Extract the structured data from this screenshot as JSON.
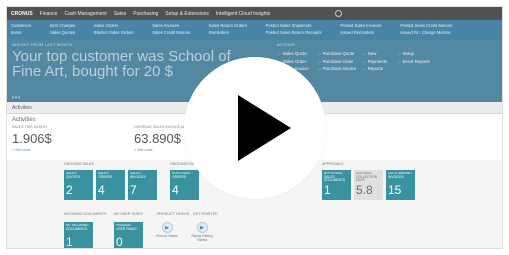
{
  "topbar": {
    "company": "CRONUS",
    "menus": [
      "Finance",
      "Cash Management",
      "Sales",
      "Purchasing",
      "Setup & Extensions",
      "Intelligent Cloud Insights"
    ]
  },
  "ribbon": {
    "links": [
      "Customers",
      "Item Charges",
      "Sales Orders",
      "Sales Invoices",
      "Sales Return Orders",
      "Posted Sales Shipments",
      "Posted Sales Invoices",
      "Posted Sales Credit Memos",
      "Items",
      "Sales Quotes",
      "Blanket Sales Orders",
      "Sales Credit Memos",
      "Reminders",
      "Posted Sales Return Receipts",
      "Issued Reminders",
      "Issued Fin. Charge Memos"
    ]
  },
  "hero": {
    "panel_label": "INSIGHT FROM LAST MONTH",
    "actions_label": "ACTIONS",
    "headline": "Your top customer was School of Fine Art, bought for 20 $",
    "actions": [
      [
        "Sales Quote",
        "Sales Order",
        "Sales Invoice"
      ],
      [
        "Purchase Quote",
        "Purchase Order",
        "Purchase Invoice"
      ],
      [
        "New",
        "Payments",
        "Reports"
      ],
      [
        "Setup",
        "Excel Reports"
      ]
    ],
    "dots": "• • •"
  },
  "activities": {
    "bar_label": "Activities",
    "title": "Activities",
    "cues": [
      {
        "label": "SALES THIS MONTH",
        "value": "1.906$",
        "link": "> See more"
      },
      {
        "label": "OVERDUE SALES INVOICE AMOUNT",
        "value": "63.890$",
        "link": "> See more"
      }
    ]
  },
  "cards": {
    "groups": [
      "ONGOING SALES",
      "ONGOING PURCHASES",
      "APPROVALS"
    ],
    "tiles": [
      {
        "label": "SALES QUOTES",
        "value": "2"
      },
      {
        "label": "SALES ORDERS",
        "value": "4"
      },
      {
        "label": "SALES INVOICES",
        "value": "7"
      },
      {
        "label": "PURCHASE ORDERS",
        "value": "4"
      },
      {
        "label": "APPROVED SALES DOCUMENTS",
        "value": "1"
      },
      {
        "label": "AVERAGE COLLECTION DAYS",
        "value": "5.8"
      },
      {
        "label": "OUTSTANDING INVOICES",
        "value": "15"
      }
    ]
  },
  "lower": {
    "groups": [
      "INCOMING DOCUMENTS",
      "MY USER TASKS",
      "PRODUCT VIDEOS",
      "GET STARTED"
    ],
    "tiles": [
      {
        "label": "MY INCOMING DOCUMENTS",
        "value": "1"
      },
      {
        "label": "PENDING USER TASKS",
        "value": "0"
      }
    ],
    "icons": [
      {
        "label": "Product Videos"
      },
      {
        "label": "Replay Getting Started"
      }
    ]
  },
  "video": {
    "play_icon": "play-icon"
  }
}
